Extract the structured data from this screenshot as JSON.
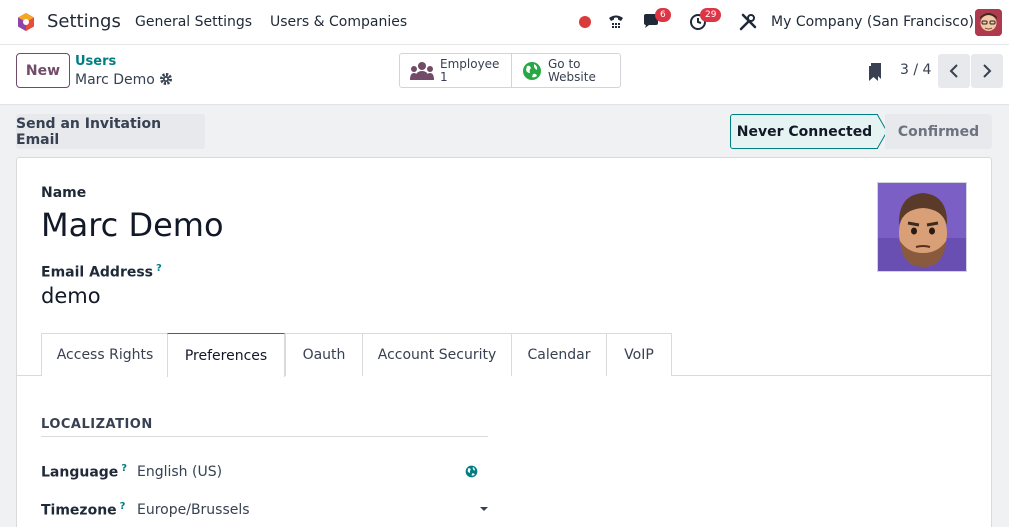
{
  "navbar": {
    "app_name": "Settings",
    "menus": [
      "General Settings",
      "Users & Companies"
    ],
    "chat_badge": "6",
    "activity_badge": "29",
    "company": "My Company (San Francisco)"
  },
  "control": {
    "new_label": "New",
    "breadcrumb_parent": "Users",
    "breadcrumb_current": "Marc Demo",
    "smart_buttons": [
      {
        "label": "Employee",
        "value": "1",
        "icon": "users-icon"
      },
      {
        "label": "Go to",
        "value": "Website",
        "icon": "globe-icon"
      }
    ],
    "pager": "3 / 4"
  },
  "status": {
    "invite_label": "Send an Invitation Email",
    "stages": [
      "Never Connected",
      "Confirmed"
    ],
    "active_stage": "Never Connected"
  },
  "form": {
    "name_label": "Name",
    "name_value": "Marc Demo",
    "email_label": "Email Address",
    "email_help": "?",
    "email_value": "demo",
    "tabs": [
      "Access Rights",
      "Preferences",
      "Oauth",
      "Account Security",
      "Calendar",
      "VoIP"
    ],
    "active_tab": "Preferences",
    "section_title": "LOCALIZATION",
    "fields": [
      {
        "label": "Language",
        "help": "?",
        "value": "English (US)"
      },
      {
        "label": "Timezone",
        "help": "?",
        "value": "Europe/Brussels"
      }
    ]
  },
  "colors": {
    "brand": "#714b67",
    "teal": "#017e84",
    "badge": "#dc3545"
  }
}
